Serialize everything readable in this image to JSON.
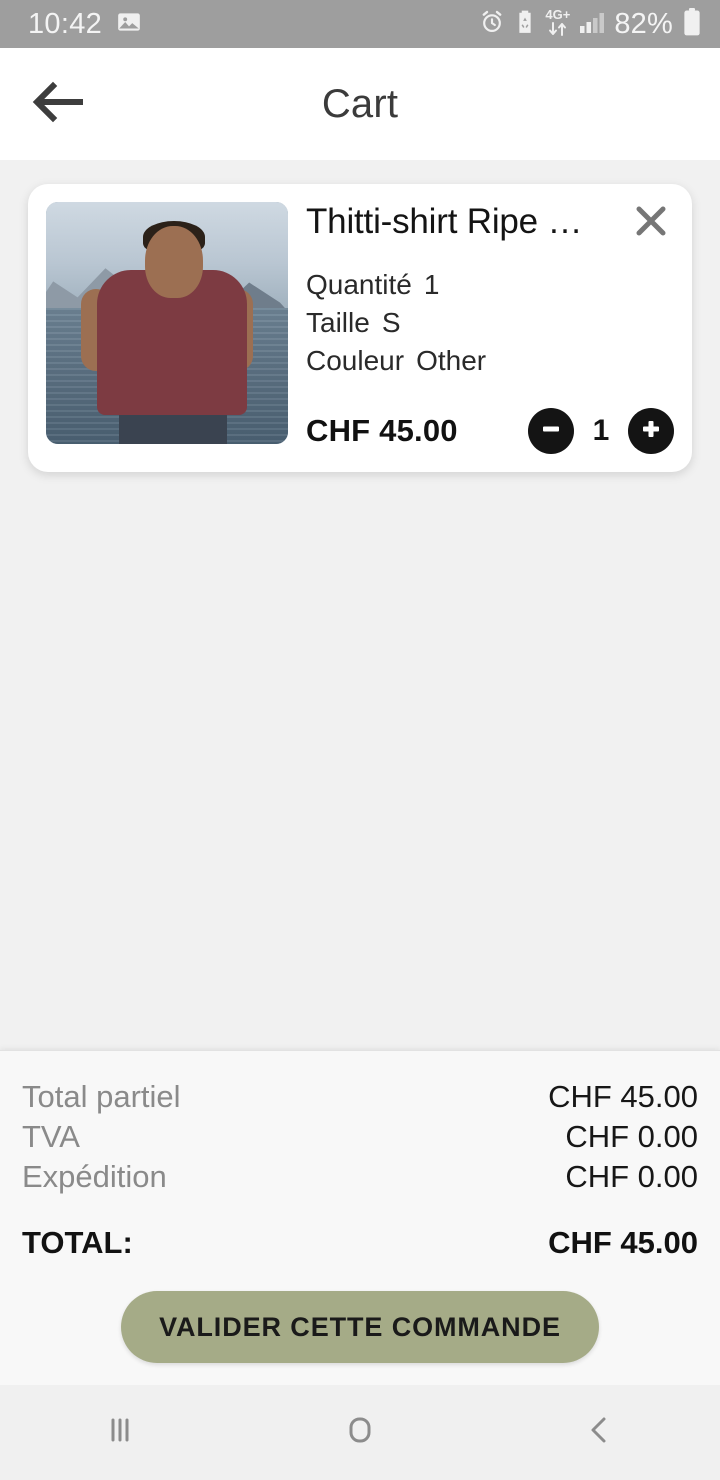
{
  "status_bar": {
    "time": "10:42",
    "photo_icon": "image-icon",
    "alarm_icon": "alarm-clock-icon",
    "battery_saver_icon": "battery-saver-icon",
    "network_label": "4G+",
    "data_arrows_icon": "data-transfer-icon",
    "signal_icon": "signal-bars-icon",
    "battery_percent": "82%",
    "battery_icon": "battery-icon"
  },
  "app_bar": {
    "back_icon": "arrow-left-icon",
    "title": "Cart"
  },
  "cart": {
    "items": [
      {
        "image_alt": "man-wearing-maroon-tshirt-by-lake",
        "title": "Thitti-shirt Ripe …",
        "remove_icon": "close-icon",
        "attributes": [
          {
            "label": "Quantité",
            "value": "1"
          },
          {
            "label": "Taille",
            "value": "S"
          },
          {
            "label": "Couleur",
            "value": "Other"
          }
        ],
        "price": "CHF 45.00",
        "decrement_icon": "minus-circle-icon",
        "quantity": "1",
        "increment_icon": "plus-circle-icon"
      }
    ]
  },
  "summary": {
    "rows": [
      {
        "label": "Total partiel",
        "value": "CHF 45.00"
      },
      {
        "label": "TVA",
        "value": "CHF 0.00"
      },
      {
        "label": "Expédition",
        "value": "CHF 0.00"
      }
    ],
    "grand_total": {
      "label": "TOTAL:",
      "value": "CHF 45.00"
    },
    "checkout_label": "VALIDER CETTE COMMANDE",
    "accent_color": "#a5ab87"
  },
  "nav_bar": {
    "recents_icon": "recents-icon",
    "home_icon": "home-icon",
    "back_icon": "back-chevron-icon"
  }
}
